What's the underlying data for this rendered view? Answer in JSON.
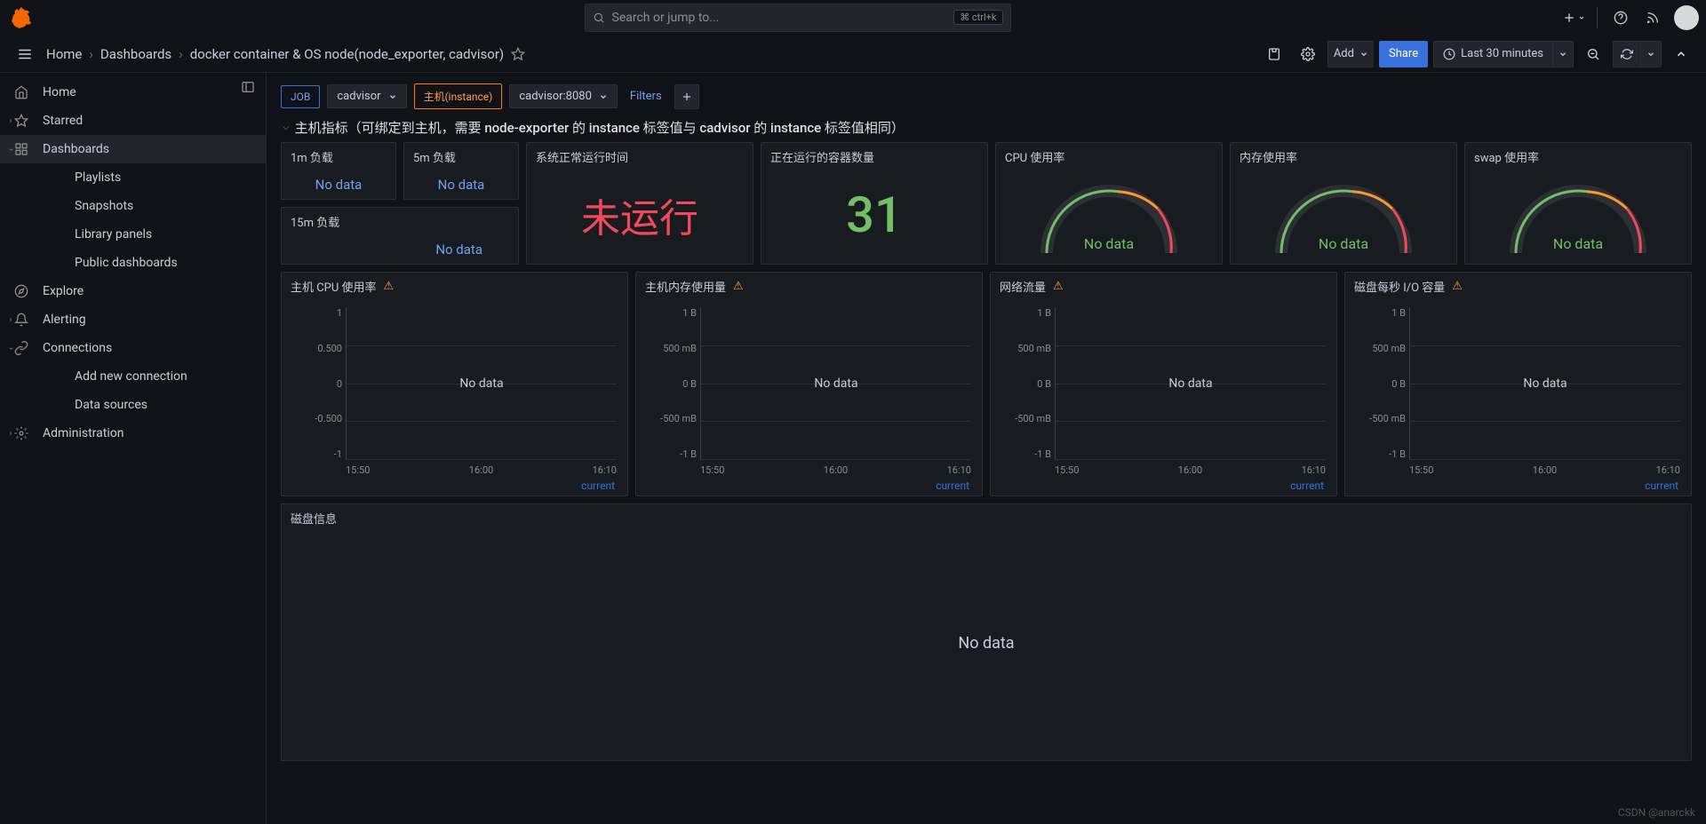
{
  "topbar": {
    "search_placeholder": "Search or jump to...",
    "shortcut": "ctrl+k"
  },
  "breadcrumb": {
    "home": "Home",
    "dashboards": "Dashboards",
    "current": "docker container & OS node(node_exporter, cadvisor)"
  },
  "toolbar": {
    "add": "Add",
    "share": "Share",
    "time_range": "Last 30 minutes"
  },
  "sidebar": {
    "home": "Home",
    "starred": "Starred",
    "dashboards": "Dashboards",
    "playlists": "Playlists",
    "snapshots": "Snapshots",
    "library_panels": "Library panels",
    "public_dashboards": "Public dashboards",
    "explore": "Explore",
    "alerting": "Alerting",
    "connections": "Connections",
    "add_new_connection": "Add new connection",
    "data_sources": "Data sources",
    "administration": "Administration"
  },
  "variables": {
    "job_label": "JOB",
    "job_value": "cadvisor",
    "host_label": "主机(instance)",
    "host_value": "cadvisor:8080",
    "filters": "Filters"
  },
  "row1_title": "主机指标（可绑定到主机，需要 node-exporter 的 instance 标签值与 cadvisor 的 instance 标签值相同）",
  "panels": {
    "load1": {
      "title": "1m 负载",
      "value": "No data"
    },
    "load5": {
      "title": "5m 负载",
      "value": "No data"
    },
    "load15": {
      "title": "15m 负载",
      "value": "No data"
    },
    "uptime": {
      "title": "系统正常运行时间",
      "value": "未运行"
    },
    "containers": {
      "title": "正在运行的容器数量",
      "value": "31"
    },
    "cpu": {
      "title": "CPU 使用率",
      "value": "No data"
    },
    "mem": {
      "title": "内存使用率",
      "value": "No data"
    },
    "swap": {
      "title": "swap 使用率",
      "value": "No data"
    },
    "host_cpu": {
      "title": "主机 CPU 使用率",
      "nodata": "No data",
      "legend": "current"
    },
    "host_mem": {
      "title": "主机内存使用量",
      "nodata": "No data",
      "legend": "current"
    },
    "net": {
      "title": "网络流量",
      "nodata": "No data",
      "legend": "current"
    },
    "disk_io": {
      "title": "磁盘每秒 I/O 容量",
      "nodata": "No data",
      "legend": "current"
    },
    "disk_info": {
      "title": "磁盘信息",
      "nodata": "No data"
    }
  },
  "chart_data": [
    {
      "type": "line",
      "title": "主机 CPU 使用率",
      "x_ticks": [
        "15:50",
        "16:00",
        "16:10"
      ],
      "y_ticks": [
        "1",
        "0.500",
        "0",
        "-0.500",
        "-1"
      ],
      "series": [],
      "nodata": true
    },
    {
      "type": "line",
      "title": "主机内存使用量",
      "x_ticks": [
        "15:50",
        "16:00",
        "16:10"
      ],
      "y_ticks": [
        "1 B",
        "500 mB",
        "0 B",
        "-500 mB",
        "-1 B"
      ],
      "series": [],
      "nodata": true
    },
    {
      "type": "line",
      "title": "网络流量",
      "x_ticks": [
        "15:50",
        "16:00",
        "16:10"
      ],
      "y_ticks": [
        "1 B",
        "500 mB",
        "0 B",
        "-500 mB",
        "-1 B"
      ],
      "series": [],
      "nodata": true
    },
    {
      "type": "line",
      "title": "磁盘每秒 I/O 容量",
      "x_ticks": [
        "15:50",
        "16:00",
        "16:10"
      ],
      "y_ticks": [
        "1 B",
        "500 mB",
        "0 B",
        "-500 mB",
        "-1 B"
      ],
      "series": [],
      "nodata": true
    }
  ],
  "watermark": "CSDN @anarckk"
}
